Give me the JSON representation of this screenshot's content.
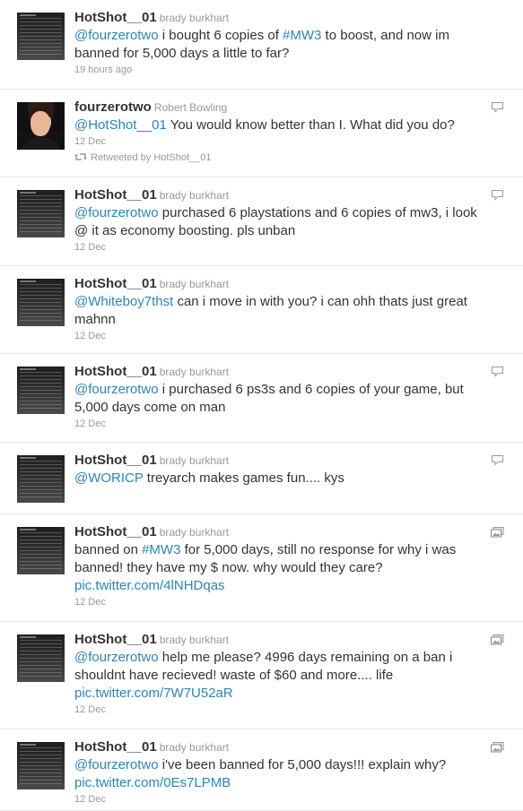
{
  "tweets": [
    {
      "screen_name": "HotShot__01",
      "full_name": "brady burkhart",
      "avatar": "black-screenshot-avatar",
      "segments": [
        {
          "t": "mention",
          "v": "@fourzerotwo"
        },
        {
          "t": "text",
          "v": " i bought 6 copies of "
        },
        {
          "t": "hashtag",
          "v": "#MW3"
        },
        {
          "t": "text",
          "v": " to boost, and now im banned for 5,000 days a little to far?"
        }
      ],
      "time": "19 hours ago",
      "corner_icon": "none"
    },
    {
      "screen_name": "fourzerotwo",
      "full_name": "Robert Bowling",
      "avatar": "photo-avatar",
      "segments": [
        {
          "t": "mention",
          "v": "@HotShot__01"
        },
        {
          "t": "text",
          "v": " You would know better than I. What did you do?"
        }
      ],
      "time": "12 Dec",
      "retweeted_by": "Retweeted by HotShot__01",
      "corner_icon": "reply-bubble-icon"
    },
    {
      "screen_name": "HotShot__01",
      "full_name": "brady burkhart",
      "avatar": "black-screenshot-avatar",
      "segments": [
        {
          "t": "mention",
          "v": "@fourzerotwo"
        },
        {
          "t": "text",
          "v": " purchased 6 playstations and 6 copies of mw3, i look @ it as economy boosting. pls unban"
        }
      ],
      "time": "12 Dec",
      "corner_icon": "reply-bubble-icon"
    },
    {
      "screen_name": "HotShot__01",
      "full_name": "brady burkhart",
      "avatar": "black-screenshot-avatar",
      "segments": [
        {
          "t": "mention",
          "v": "@Whiteboy7thst"
        },
        {
          "t": "text",
          "v": " can i move in with you? i can ohh thats just great mahnn"
        }
      ],
      "time": "12 Dec",
      "corner_icon": "none"
    },
    {
      "screen_name": "HotShot__01",
      "full_name": "brady burkhart",
      "avatar": "black-screenshot-avatar",
      "segments": [
        {
          "t": "mention",
          "v": "@fourzerotwo"
        },
        {
          "t": "text",
          "v": " i purchased 6 ps3s and 6 copies of your game, but 5,000 days come on man"
        }
      ],
      "time": "12 Dec",
      "corner_icon": "reply-bubble-icon"
    },
    {
      "screen_name": "HotShot__01",
      "full_name": "brady burkhart",
      "avatar": "black-screenshot-avatar",
      "segments": [
        {
          "t": "mention",
          "v": "@WORICP"
        },
        {
          "t": "text",
          "v": " treyarch makes games fun.... kys"
        }
      ],
      "time": "",
      "corner_icon": "reply-bubble-icon"
    },
    {
      "screen_name": "HotShot__01",
      "full_name": "brady burkhart",
      "avatar": "black-screenshot-avatar",
      "segments": [
        {
          "t": "text",
          "v": "banned on "
        },
        {
          "t": "hashtag",
          "v": "#MW3"
        },
        {
          "t": "text",
          "v": " for 5,000 days, still no response for why i was banned! they have my $ now. why would they care? "
        },
        {
          "t": "link",
          "v": "pic.twitter.com/4lNHDqas"
        }
      ],
      "time": "12 Dec",
      "corner_icon": "image-icon"
    },
    {
      "screen_name": "HotShot__01",
      "full_name": "brady burkhart",
      "avatar": "black-screenshot-avatar",
      "segments": [
        {
          "t": "mention",
          "v": "@fourzerotwo"
        },
        {
          "t": "text",
          "v": " help me please? 4996 days remaining on a ban i shouldnt have recieved! waste of $60 and more.... life "
        },
        {
          "t": "link",
          "v": "pic.twitter.com/7W7U52aR"
        }
      ],
      "time": "12 Dec",
      "corner_icon": "image-icon"
    },
    {
      "screen_name": "HotShot__01",
      "full_name": "brady burkhart",
      "avatar": "black-screenshot-avatar",
      "segments": [
        {
          "t": "mention",
          "v": "@fourzerotwo"
        },
        {
          "t": "text",
          "v": " i've been banned for 5,000 days!!! explain why? "
        },
        {
          "t": "link",
          "v": "pic.twitter.com/0Es7LPMB"
        }
      ],
      "time": "12 Dec",
      "corner_icon": "image-icon"
    }
  ],
  "colors": {
    "link": "#2a85b9",
    "text": "#333333",
    "meta": "#999999",
    "divider": "#e8e8e8"
  }
}
